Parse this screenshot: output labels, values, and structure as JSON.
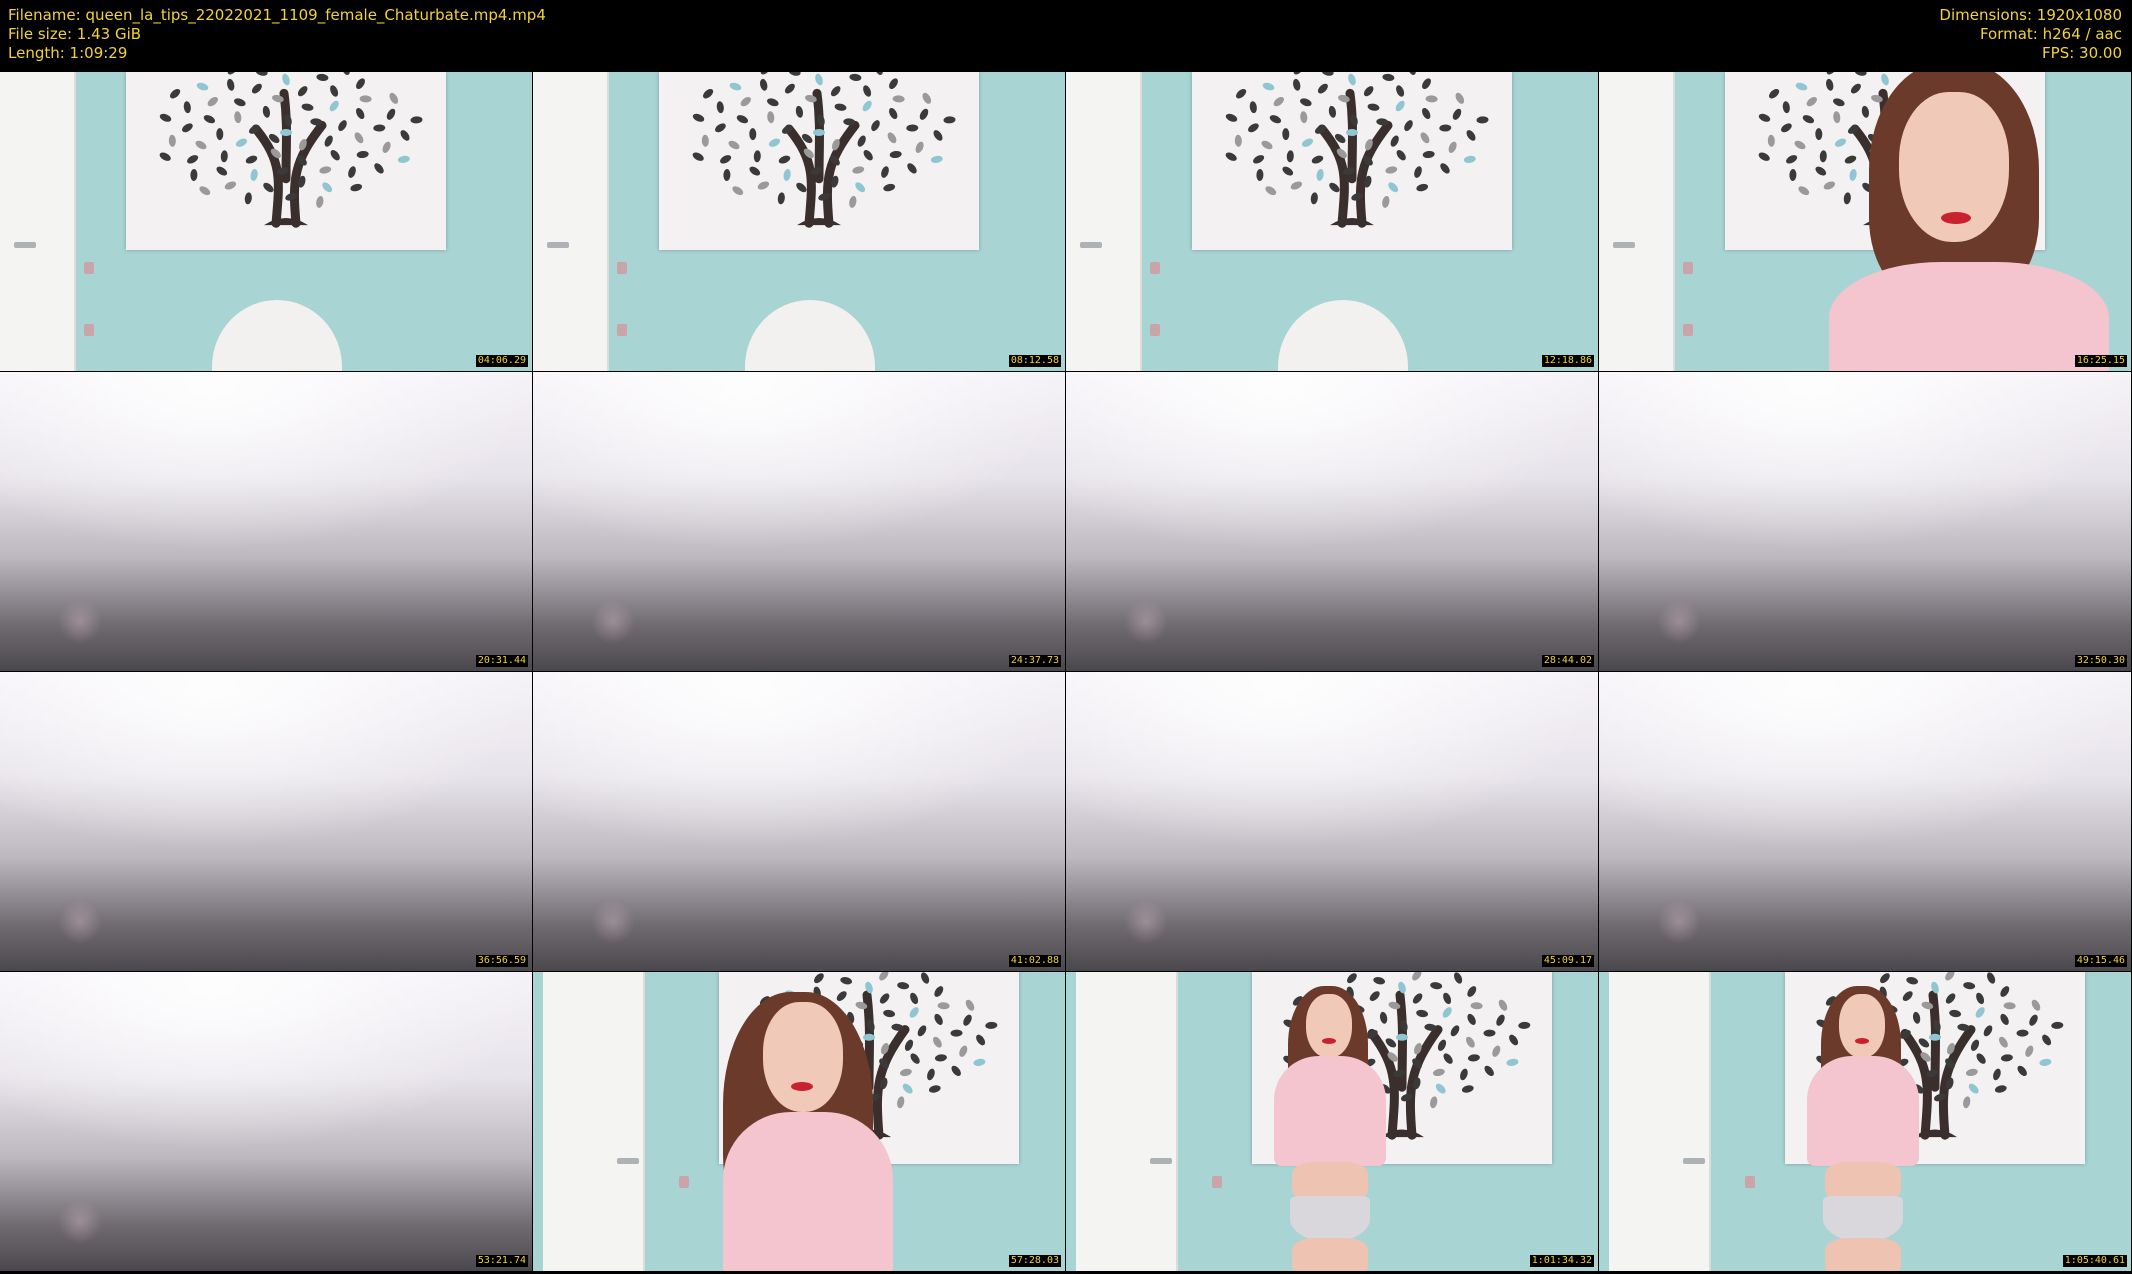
{
  "header": {
    "filename": "Filename: queen_la_tips_22022021_1109_female_Chaturbate.mp4.mp4",
    "filesize": "File size: 1.43 GiB",
    "length": "Length: 1:09:29",
    "dimensions": "Dimensions: 1920x1080",
    "format": "Format: h264 / aac",
    "fps": "FPS: 30.00"
  },
  "thumbnails": [
    {
      "time": "04:06.29",
      "scene": "room-empty"
    },
    {
      "time": "08:12.58",
      "scene": "room-empty"
    },
    {
      "time": "12:18.86",
      "scene": "room-empty"
    },
    {
      "time": "16:25.15",
      "scene": "room-closeup"
    },
    {
      "time": "20:31.44",
      "scene": "fog"
    },
    {
      "time": "24:37.73",
      "scene": "fog"
    },
    {
      "time": "28:44.02",
      "scene": "fog"
    },
    {
      "time": "32:50.30",
      "scene": "fog"
    },
    {
      "time": "36:56.59",
      "scene": "fog"
    },
    {
      "time": "41:02.88",
      "scene": "fog"
    },
    {
      "time": "45:09.17",
      "scene": "fog"
    },
    {
      "time": "49:15.46",
      "scene": "fog"
    },
    {
      "time": "53:21.74",
      "scene": "fog"
    },
    {
      "time": "57:28.03",
      "scene": "room-leaning"
    },
    {
      "time": "1:01:34.32",
      "scene": "room-standing"
    },
    {
      "time": "1:05:40.61",
      "scene": "room-standing"
    }
  ],
  "colors": {
    "header_text": "#f1d23a",
    "background": "#000000",
    "wall": "#a9d4d4"
  }
}
